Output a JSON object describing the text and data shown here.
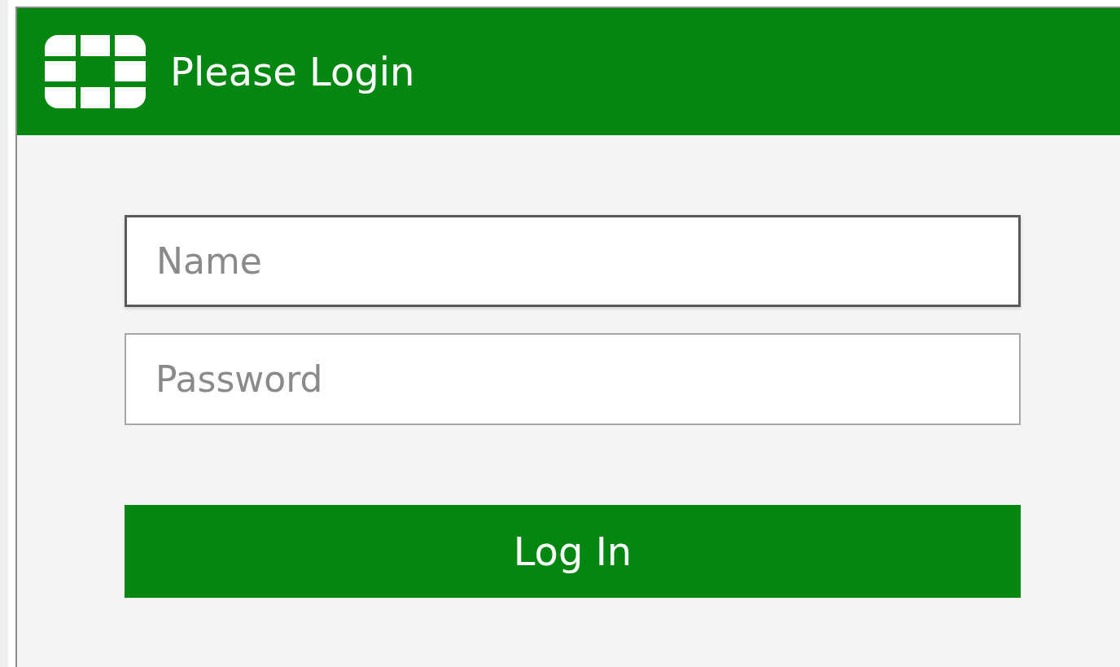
{
  "header": {
    "title": "Please Login"
  },
  "fields": [
    {
      "placeholder": "Name",
      "focused": true
    },
    {
      "placeholder": "Password",
      "focused": false
    }
  ],
  "button": {
    "label": "Log In"
  }
}
